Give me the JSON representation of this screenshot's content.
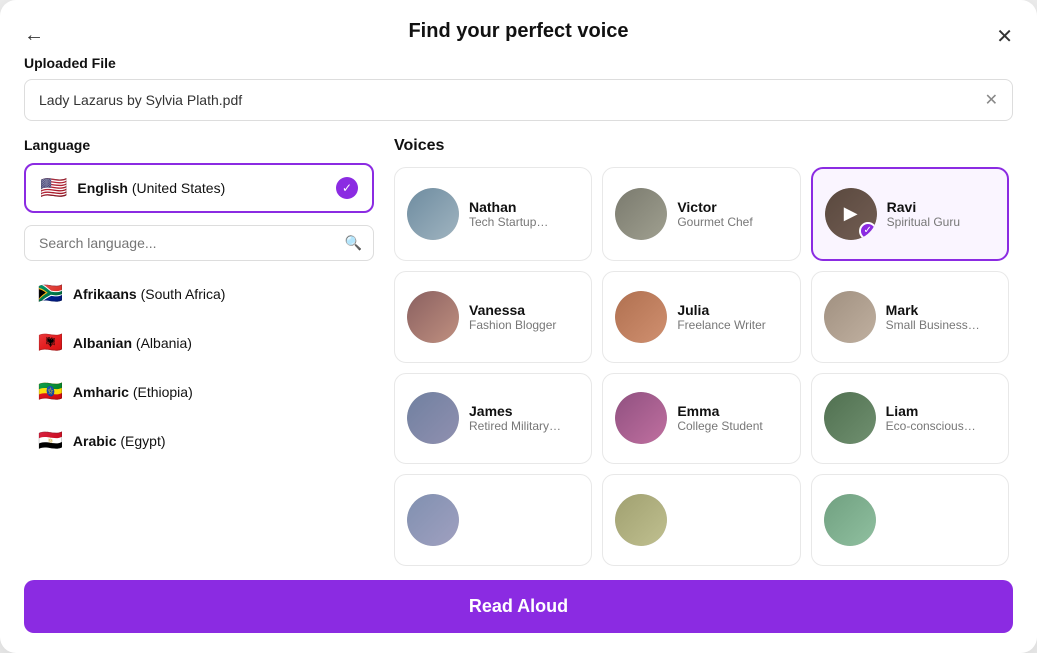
{
  "modal": {
    "title": "Find your perfect voice",
    "back_label": "←",
    "close_label": "✕"
  },
  "file_section": {
    "label": "Uploaded File",
    "file_name": "Lady Lazarus by Sylvia Plath.pdf",
    "clear_label": "✕"
  },
  "language": {
    "label": "Language",
    "selected": {
      "flag": "🇺🇸",
      "name_bold": "English",
      "name_rest": " (United States)"
    },
    "search_placeholder": "Search language...",
    "items": [
      {
        "flag": "🇿🇦",
        "name_bold": "Afrikaans",
        "name_rest": " (South Africa)"
      },
      {
        "flag": "🇦🇱",
        "name_bold": "Albanian",
        "name_rest": " (Albania)"
      },
      {
        "flag": "🇪🇹",
        "name_bold": "Amharic",
        "name_rest": " (Ethiopia)"
      },
      {
        "flag": "🇪🇬",
        "name_bold": "Arabic",
        "name_rest": " (Egypt)"
      }
    ]
  },
  "voices": {
    "label": "Voices",
    "items": [
      {
        "id": "nathan",
        "name": "Nathan",
        "desc": "Tech Startup…",
        "avatar_class": "av-nathan",
        "selected": false,
        "playing": false
      },
      {
        "id": "victor",
        "name": "Victor",
        "desc": "Gourmet Chef",
        "avatar_class": "av-victor",
        "selected": false,
        "playing": false
      },
      {
        "id": "ravi",
        "name": "Ravi",
        "desc": "Spiritual Guru",
        "avatar_class": "av-ravi",
        "selected": true,
        "playing": true
      },
      {
        "id": "vanessa",
        "name": "Vanessa",
        "desc": "Fashion Blogger",
        "avatar_class": "av-vanessa",
        "selected": false,
        "playing": false
      },
      {
        "id": "julia",
        "name": "Julia",
        "desc": "Freelance Writer",
        "avatar_class": "av-julia",
        "selected": false,
        "playing": false
      },
      {
        "id": "mark",
        "name": "Mark",
        "desc": "Small Business…",
        "avatar_class": "av-mark",
        "selected": false,
        "playing": false
      },
      {
        "id": "james",
        "name": "James",
        "desc": "Retired Military…",
        "avatar_class": "av-james",
        "selected": false,
        "playing": false
      },
      {
        "id": "emma",
        "name": "Emma",
        "desc": "College Student",
        "avatar_class": "av-emma",
        "selected": false,
        "playing": false
      },
      {
        "id": "liam",
        "name": "Liam",
        "desc": "Eco-conscious…",
        "avatar_class": "av-liam",
        "selected": false,
        "playing": false
      }
    ],
    "partial": [
      {
        "id": "partial1",
        "avatar_class": "av-partial1"
      },
      {
        "id": "partial2",
        "avatar_class": "av-partial2"
      },
      {
        "id": "partial3",
        "avatar_class": "av-partial3"
      }
    ]
  },
  "bottom": {
    "read_aloud_label": "Read Aloud"
  }
}
